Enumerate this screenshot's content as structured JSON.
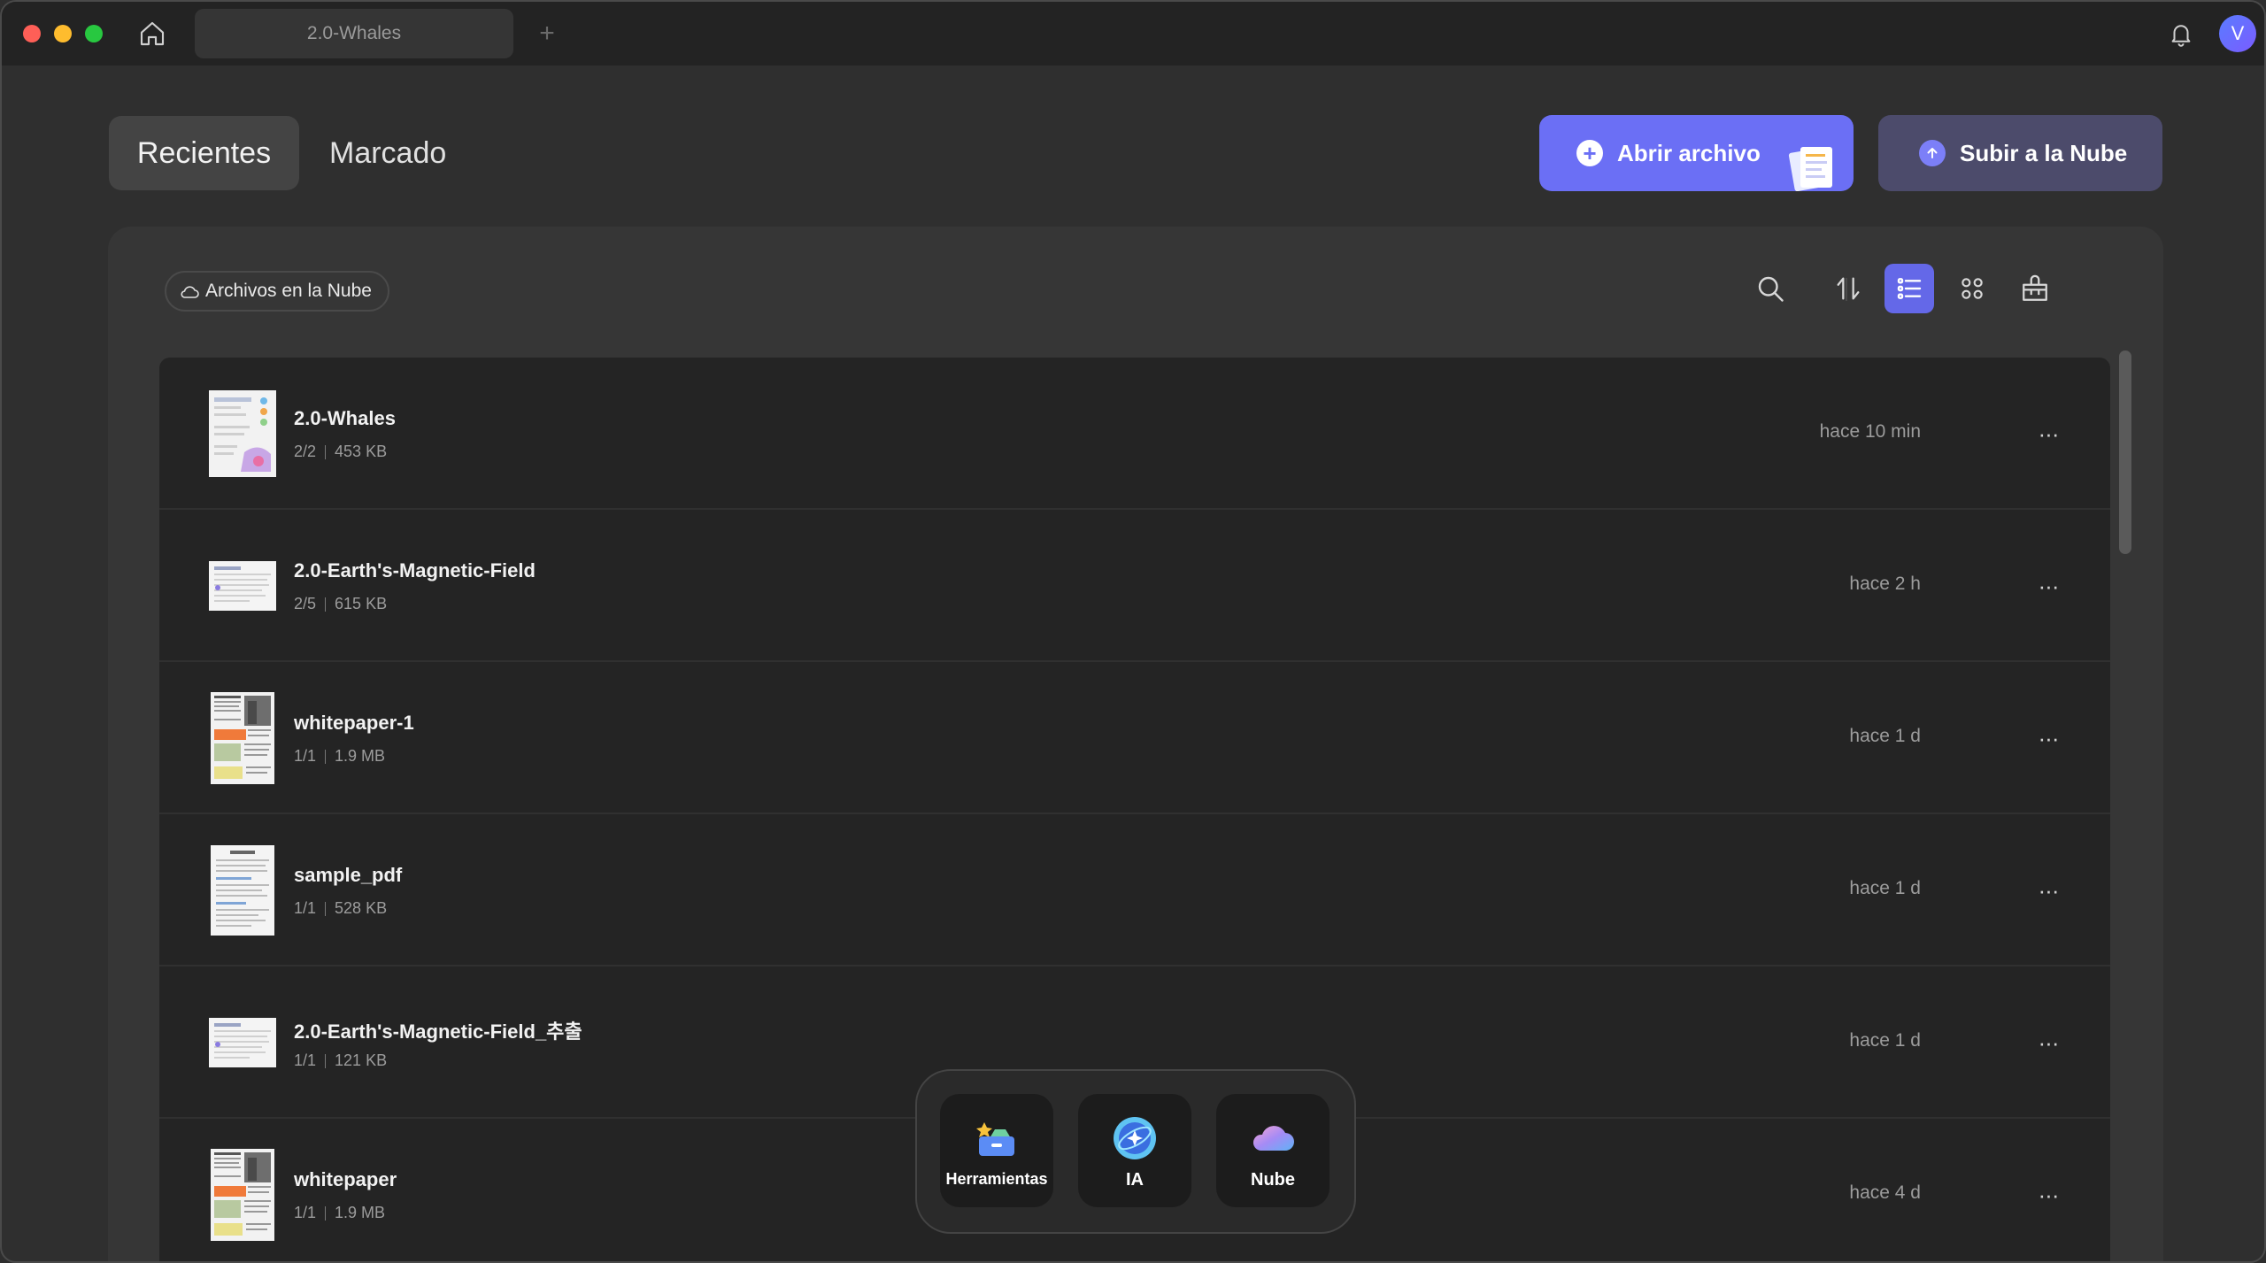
{
  "titlebar": {
    "tab_title": "2.0-Whales",
    "new_tab": "+",
    "avatar_initial": "V"
  },
  "header": {
    "tab_recent": "Recientes",
    "tab_marked": "Marcado",
    "open_file": "Abrir archivo",
    "upload_cloud": "Subir a la Nube"
  },
  "toolbar": {
    "cloud_files": "Archivos en la Nube",
    "view_mode": "list"
  },
  "files": [
    {
      "name": "2.0-Whales",
      "pages": "2/2",
      "size": "453 KB",
      "time": "hace 10 min",
      "thumb": "landscape-color"
    },
    {
      "name": "2.0-Earth's-Magnetic-Field",
      "pages": "2/5",
      "size": "615 KB",
      "time": "hace 2 h",
      "thumb": "landscape-text"
    },
    {
      "name": "whitepaper-1",
      "pages": "1/1",
      "size": "1.9 MB",
      "time": "hace 1 d",
      "thumb": "portrait-photo"
    },
    {
      "name": "sample_pdf",
      "pages": "1/1",
      "size": "528 KB",
      "time": "hace 1 d",
      "thumb": "portrait-text"
    },
    {
      "name": "2.0-Earth's-Magnetic-Field_추출",
      "pages": "1/1",
      "size": "121 KB",
      "time": "hace 1 d",
      "thumb": "landscape-text"
    },
    {
      "name": "whitepaper",
      "pages": "1/1",
      "size": "1.9 MB",
      "time": "hace 4 d",
      "thumb": "portrait-photo"
    }
  ],
  "dock": {
    "tools": "Herramientas",
    "ai": "IA",
    "cloud": "Nube"
  },
  "colors": {
    "accent": "#6b6ff5",
    "accent_secondary": "#4c4b6b",
    "background": "#2f2f2f",
    "list_background": "#242424"
  }
}
